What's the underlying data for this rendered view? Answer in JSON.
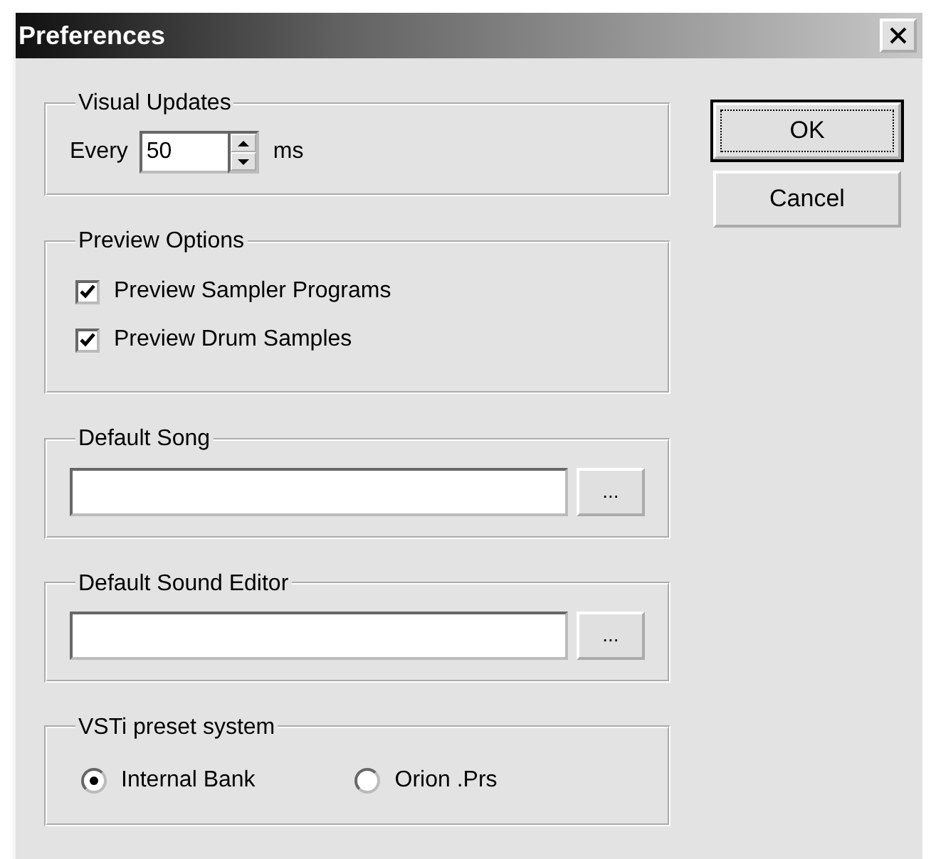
{
  "window": {
    "title": "Preferences"
  },
  "groups": [
    {
      "kind": "spinner",
      "title": "Visual Updates",
      "label": "Every",
      "value": "50",
      "unit": "ms"
    },
    {
      "kind": "checkboxes",
      "title": "Preview Options",
      "items": [
        {
          "label": "Preview Sampler Programs",
          "checked": true
        },
        {
          "label": "Preview Drum Samples",
          "checked": true
        }
      ]
    },
    {
      "kind": "path",
      "title": "Default Song",
      "browse": "..."
    },
    {
      "kind": "path",
      "title": "Default Sound Editor",
      "browse": "..."
    },
    {
      "kind": "radios",
      "title": "VSTi preset system",
      "options": [
        {
          "label": "Internal Bank",
          "selected": true
        },
        {
          "label": "Orion .Prs",
          "selected": false
        }
      ]
    }
  ],
  "buttons": [
    {
      "label": "OK",
      "default": true
    },
    {
      "label": "Cancel",
      "default": false
    }
  ]
}
